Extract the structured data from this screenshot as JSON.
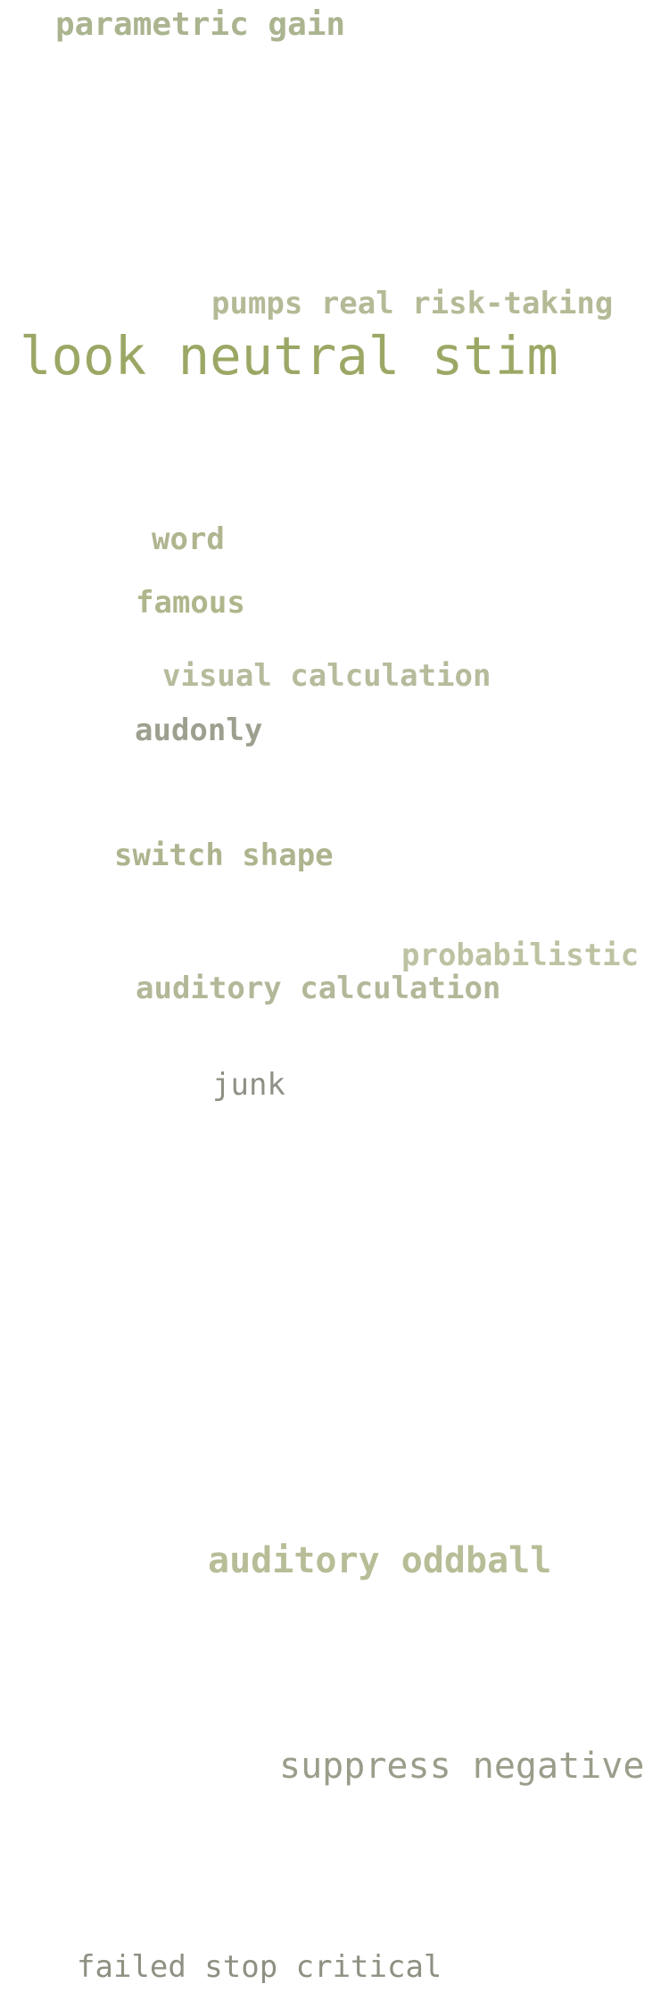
{
  "words": [
    {
      "text": "parametric gain",
      "color": "#aab48f",
      "weight": "bold"
    },
    {
      "text": "pumps real risk-taking",
      "color": "#b4ba96",
      "weight": "bold"
    },
    {
      "text": "look neutral stim",
      "color": "#9ba865",
      "weight": "normal"
    },
    {
      "text": "word",
      "color": "#b1b58f",
      "weight": "bold"
    },
    {
      "text": "famous",
      "color": "#b0b68c",
      "weight": "bold"
    },
    {
      "text": "visual calculation",
      "color": "#b7bb9c",
      "weight": "bold"
    },
    {
      "text": "audonly",
      "color": "#9ea08f",
      "weight": "bold"
    },
    {
      "text": "switch shape",
      "color": "#aeb48e",
      "weight": "bold"
    },
    {
      "text": "probabilistic",
      "color": "#bdc2a2",
      "weight": "bold"
    },
    {
      "text": "auditory calculation",
      "color": "#b2b898",
      "weight": "bold"
    },
    {
      "text": "junk",
      "color": "#8f9085",
      "weight": "normal"
    },
    {
      "text": "auditory oddball",
      "color": "#b8bd97",
      "weight": "bold"
    },
    {
      "text": "suppress negative",
      "color": "#9a9d8a",
      "weight": "normal"
    },
    {
      "text": "failed stop critical",
      "color": "#8e9082",
      "weight": "normal"
    }
  ]
}
